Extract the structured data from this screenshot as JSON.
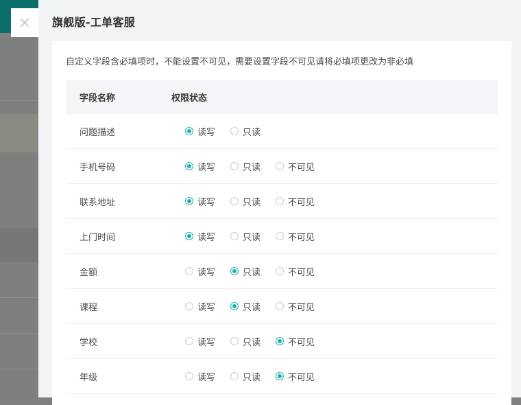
{
  "drawer": {
    "title": "旗舰版-工单客服",
    "notice": "自定义字段含必填项时，不能设置不可见，需要设置字段不可见请将必填项更改为非必填"
  },
  "table": {
    "headers": {
      "name": "字段名称",
      "permission": "权限状态"
    },
    "options": [
      "读写",
      "只读",
      "不可见"
    ],
    "rows": [
      {
        "name": "问题描述",
        "selected": "读写",
        "options": [
          "读写",
          "只读"
        ]
      },
      {
        "name": "手机号码",
        "selected": "读写",
        "options": [
          "读写",
          "只读",
          "不可见"
        ]
      },
      {
        "name": "联系地址",
        "selected": "读写",
        "options": [
          "读写",
          "只读",
          "不可见"
        ]
      },
      {
        "name": "上门时间",
        "selected": "读写",
        "options": [
          "读写",
          "只读",
          "不可见"
        ]
      },
      {
        "name": "金额",
        "selected": "只读",
        "options": [
          "读写",
          "只读",
          "不可见"
        ]
      },
      {
        "name": "课程",
        "selected": "只读",
        "options": [
          "读写",
          "只读",
          "不可见"
        ]
      },
      {
        "name": "学校",
        "selected": "不可见",
        "options": [
          "读写",
          "只读",
          "不可见"
        ]
      },
      {
        "name": "年级",
        "selected": "不可见",
        "options": [
          "读写",
          "只读",
          "不可见"
        ]
      }
    ]
  },
  "colors": {
    "accent": "#16b3a9",
    "close_icon": "#c0c4cc"
  },
  "icons": {
    "close": "close-icon"
  }
}
